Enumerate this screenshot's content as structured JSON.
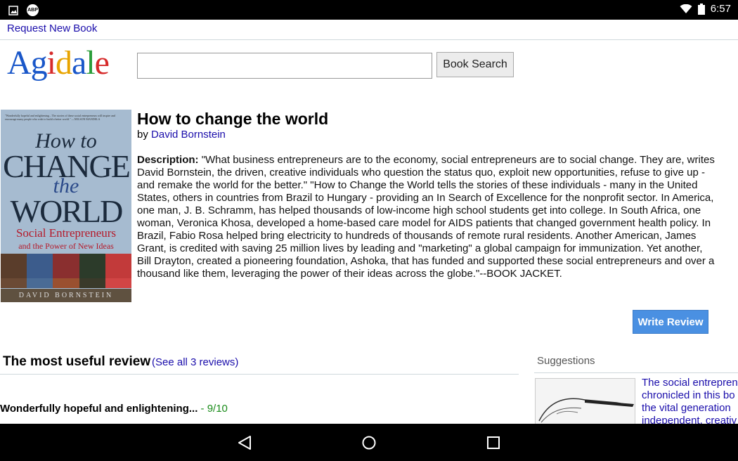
{
  "status_bar": {
    "time": "6:57",
    "left_icons": [
      "image-icon",
      "abp-icon"
    ],
    "abp_label": "ABP",
    "right_icons": [
      "wifi-icon",
      "battery-icon"
    ]
  },
  "top_nav": {
    "request_link": "Request New Book"
  },
  "header": {
    "logo": {
      "letters": [
        {
          "ch": "A",
          "color": "#1a57c9"
        },
        {
          "ch": "g",
          "color": "#1a57c9"
        },
        {
          "ch": "i",
          "color": "#d62a2a"
        },
        {
          "ch": "d",
          "color": "#e8a400"
        },
        {
          "ch": "a",
          "color": "#1a57c9"
        },
        {
          "ch": "l",
          "color": "#2a9d3a"
        },
        {
          "ch": "e",
          "color": "#d62a2a"
        }
      ]
    },
    "search": {
      "value": "",
      "placeholder": "",
      "button_label": "Book Search"
    }
  },
  "book": {
    "title": "How to change the world",
    "by_label": "by",
    "author": "David Bornstein",
    "description_label": "Description:",
    "description": "\"What business entrepreneurs are to the economy, social entrepreneurs are to social change. They are, writes David Bornstein, the driven, creative individuals who question the status quo, exploit new opportunities, refuse to give up - and remake the world for the better.\" \"How to Change the World tells the stories of these individuals - many in the United States, others in countries from Brazil to Hungary - providing an In Search of Excellence for the nonprofit sector. In America, one man, J. B. Schramm, has helped thousands of low-income high school students get into college. In South Africa, one woman, Veronica Khosa, developed a home-based care model for AIDS patients that changed government health policy. In Brazil, Fabio Rosa helped bring electricity to hundreds of thousands of remote rural residents. Another American, James Grant, is credited with saving 25 million lives by leading and \"marketing\" a global campaign for immunization. Yet another, Bill Drayton, created a pioneering foundation, Ashoka, that has funded and supported these social entrepreneurs and over a thousand like them, leveraging the power of their ideas across the globe.\"--BOOK JACKET.",
    "cover": {
      "blurb": "\"Wonderfully hopeful and enlightening... The stories of these social entrepreneurs will inspire and encourage many people who wish to build a better world.\" —NELSON MANDELA",
      "line1": "How to",
      "line2": "CHANGE",
      "line3": "the",
      "line4": "WORLD",
      "sub1": "Social Entrepreneurs",
      "sub2": "and the Power of New Ideas",
      "author": "DAVID BORNSTEIN"
    },
    "write_review_label": "Write Review"
  },
  "reviews": {
    "heading": "The most useful review",
    "see_all": "(See all 3 reviews)",
    "top_review": {
      "title": "Wonderfully hopeful and enlightening...",
      "score": " - 9/10"
    }
  },
  "suggestions": {
    "heading": "Suggestions",
    "item_lines": [
      "The social entrepren",
      "chronicled in this bo",
      "the vital generation",
      "independent, creativ"
    ]
  },
  "nav_bar": {
    "icons": [
      "back-icon",
      "home-icon",
      "recents-icon"
    ]
  }
}
